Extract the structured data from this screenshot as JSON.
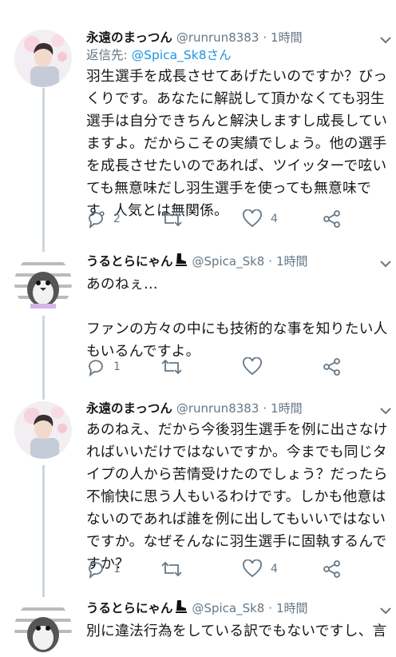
{
  "tweets": [
    {
      "name": "永遠のまっつん",
      "handle": "@runrun8383",
      "dot": "·",
      "time": "1時間",
      "reply_prefix": "返信先: ",
      "reply_to": "@Spica_Sk8さん",
      "text": "羽生選手を成長させてあげたいのですか？びっくりです。あなたに解説して頂かなくても羽生選手は自分できちんと解決しますし成長していますよ。だからこその実績でしょう。他の選手を成長させたいのであれば、ツイッターで呟いても無意味だし羽生選手を使っても無意味です。人気とは無関係。",
      "replies": "2",
      "retweets": "",
      "likes": "4"
    },
    {
      "name": "うるとらにゃん",
      "handle": "@Spica_Sk8",
      "dot": "·",
      "time": "1時間",
      "text": "あのねぇ…\n\nファンの方々の中にも技術的な事を知りたい人もいるんですよ。",
      "replies": "1",
      "retweets": "",
      "likes": ""
    },
    {
      "name": "永遠のまっつん",
      "handle": "@runrun8383",
      "dot": "·",
      "time": "1時間",
      "text": "あのねえ、だから今後羽生選手を例に出さなければいいだけではないですか。今までも同じタイプの人から苦情受けたのでしょう？だったら不愉快に思う人もいるわけです。しかも他意はないのであれば誰を例に出してもいいではないですか。なぜそんなに羽生選手に固執するんですか？",
      "replies": "1",
      "retweets": "",
      "likes": "4"
    },
    {
      "name": "うるとらにゃん",
      "handle": "@Spica_Sk8",
      "dot": "·",
      "time": "1時間",
      "text": "別に違法行為をしている訳でもないですし、言"
    }
  ],
  "icons": {
    "reply": "reply-icon",
    "retweet": "retweet-icon",
    "like": "heart-icon",
    "share": "share-icon",
    "menu": "chevron-down-icon"
  },
  "colors": {
    "text": "#14171a",
    "secondary": "#657786",
    "link": "#1b95e0",
    "thread_line": "#ccd6dd"
  }
}
